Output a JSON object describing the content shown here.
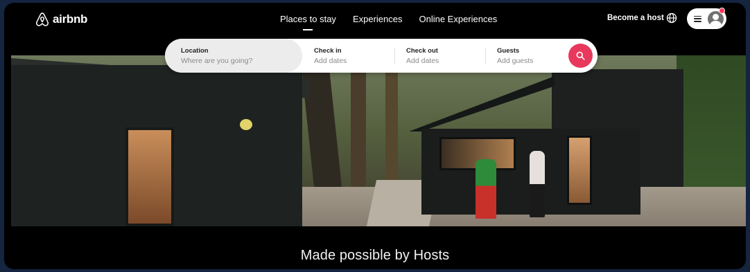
{
  "header": {
    "brand": "airbnb",
    "nav": [
      {
        "label": "Places to stay",
        "active": true
      },
      {
        "label": "Experiences",
        "active": false
      },
      {
        "label": "Online Experiences",
        "active": false
      }
    ],
    "become_host": "Become a host",
    "globe_icon": "globe-icon",
    "menu_icon": "hamburger-icon",
    "avatar_icon": "user-avatar-icon"
  },
  "search": {
    "location": {
      "label": "Location",
      "value": "Where are you going?"
    },
    "check_in": {
      "label": "Check in",
      "value": "Add dates"
    },
    "check_out": {
      "label": "Check out",
      "value": "Add dates"
    },
    "guests": {
      "label": "Guests",
      "value": "Add guests"
    },
    "button_icon": "search-icon"
  },
  "hero": {
    "tagline": "Made possible by Hosts"
  },
  "colors": {
    "brand": "#ff385c",
    "search_button": "#e8395c",
    "page_background": "#000000"
  }
}
